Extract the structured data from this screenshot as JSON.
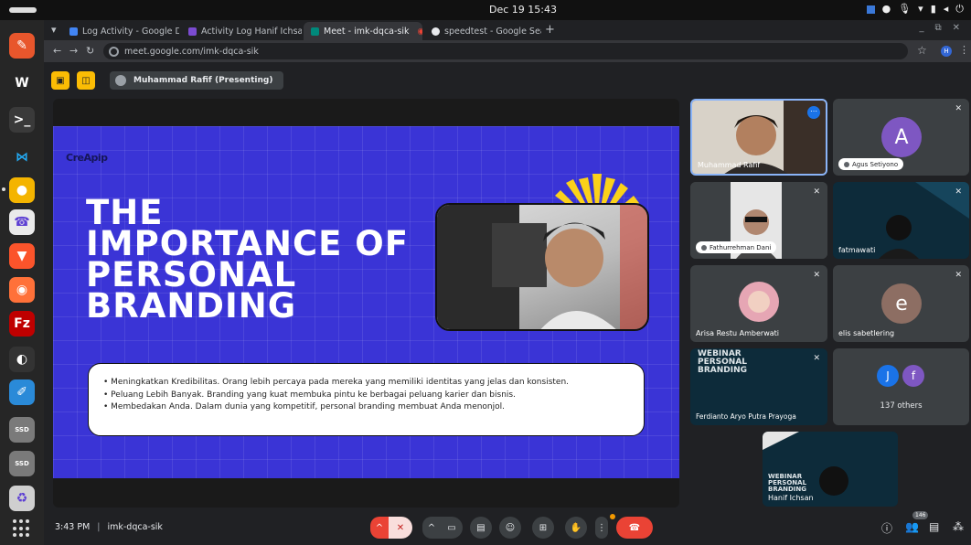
{
  "system": {
    "clock": "Dec 19  15:43"
  },
  "dock": {
    "apps": [
      {
        "name": "pencil",
        "glyph": "✎",
        "bg": "#e8562c"
      },
      {
        "name": "wps",
        "glyph": "W",
        "bg": "#262626"
      },
      {
        "name": "terminal",
        "glyph": ">_",
        "bg": "#3a3a3a"
      },
      {
        "name": "vscode",
        "glyph": "⋈",
        "bg": "#262626"
      },
      {
        "name": "chrome",
        "glyph": "●",
        "bg": "#f4b400"
      },
      {
        "name": "viber",
        "glyph": "☎",
        "bg": "#eaeaea"
      },
      {
        "name": "brave",
        "glyph": "▼",
        "bg": "#fb542b"
      },
      {
        "name": "firefox",
        "glyph": "◉",
        "bg": "#ff7139"
      },
      {
        "name": "filezilla",
        "glyph": "Fz",
        "bg": "#bf0000"
      },
      {
        "name": "obs",
        "glyph": "◐",
        "bg": "#333"
      },
      {
        "name": "text-editor",
        "glyph": "✐",
        "bg": "#2a8ad8"
      },
      {
        "name": "ssd-1",
        "glyph": "SSD",
        "bg": "#7a7a7a"
      },
      {
        "name": "ssd-2",
        "glyph": "SSD",
        "bg": "#7a7a7a"
      },
      {
        "name": "trash",
        "glyph": "♻",
        "bg": "#cfcfcf"
      }
    ]
  },
  "tabs": [
    {
      "title": "Log Activity - Google Do",
      "color": "#4285f4"
    },
    {
      "title": "Activity Log Hanif Ichsan",
      "color": "#7b4bd1"
    },
    {
      "title": "Meet - imk-dqca-sik",
      "color": "#00897b"
    },
    {
      "title": "speedtest - Google Search",
      "color": "#e8eaed"
    }
  ],
  "address": {
    "url": "meet.google.com/imk-dqca-sik",
    "profile_initial": "H"
  },
  "presenter": {
    "label": "Muhammad Rafif (Presenting)"
  },
  "slide": {
    "logo": "CreApip",
    "title_lines": [
      "THE",
      "IMPORTANCE OF",
      "PERSONAL",
      "BRANDING"
    ],
    "bullets": [
      "• Meningkatkan Kredibilitas. Orang lebih percaya pada mereka yang memiliki identitas yang jelas dan konsisten.",
      "• Peluang Lebih Banyak. Branding yang kuat membuka pintu ke berbagai peluang karier dan bisnis.",
      "• Membedakan Anda. Dalam dunia yang kompetitif, personal branding membuat Anda menonjol."
    ]
  },
  "participants": {
    "rafif": "Muhammad Rafif",
    "agus": "Agus Setiyono",
    "agus_initial": "A",
    "fathur": "Fathurrehman Dani",
    "fatmawati": "fatmawati",
    "arisa": "Arisa Restu Amberwati",
    "elis": "elis sabetlering",
    "elis_initial": "e",
    "ferdianto": "Ferdianto Aryo Putra Prayoga",
    "others_label": "137 others",
    "others_initials": [
      "J",
      "f"
    ],
    "webinar_title": "WEBINAR PERSONAL BRANDING",
    "self": "Hanif Ichsan"
  },
  "bottom": {
    "time": "3:43 PM",
    "meeting_code": "imk-dqca-sik",
    "participant_count": "146"
  }
}
